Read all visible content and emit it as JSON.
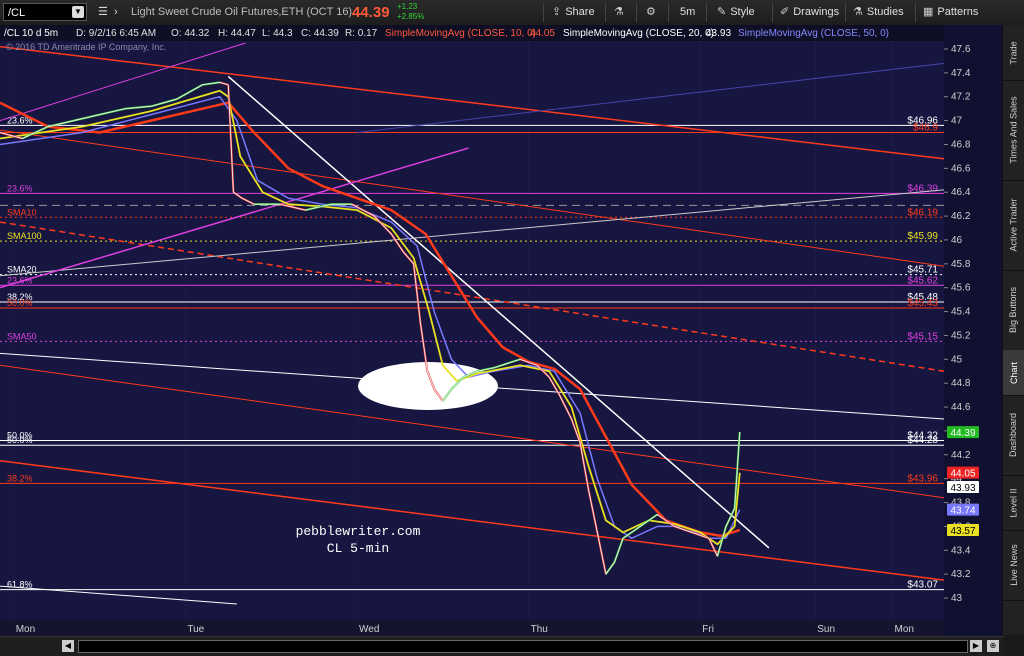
{
  "toolbar": {
    "symbol": "/CL",
    "description": "Light Sweet Crude Oil Futures,ETH (OCT 16)",
    "last_price": "44.39",
    "net_change": "+1.23",
    "pct_change": "+2.85%",
    "share": "Share",
    "aggregation": "5m",
    "style": "Style",
    "drawings": "Drawings",
    "studies": "Studies",
    "patterns": "Patterns"
  },
  "info_bar": {
    "symbol": "/CL 10 d 5m",
    "bar": "D: 9/2/16 6:45 AM",
    "open": "O: 44.32",
    "high": "H: 44.47",
    "low": "L: 44.3",
    "close": "C: 44.39",
    "range": "R: 0.17",
    "sma10_label": "SimpleMovingAvg (CLOSE, 10, 0)",
    "sma10_value": "44.05",
    "sma20_label": "SimpleMovingAvg (CLOSE, 20, 0)",
    "sma20_value": "43.93",
    "sma50_label": "SimpleMovingAvg (CLOSE, 50, 0)",
    "copyright": "© 2016 TD Ameritrade IP Company, Inc."
  },
  "side_tabs": [
    "Trade",
    "Times And Sales",
    "Active Trader",
    "Big Buttons",
    "Chart",
    "Dashboard",
    "Level II",
    "Live News"
  ],
  "side_tab_active": "Chart",
  "watermark": [
    "pebblewriter.com",
    "CL 5-min"
  ],
  "colors": {
    "background": "#161640",
    "price": "#e8e8e8",
    "sma10": "#e8e020",
    "sma20": "#7878ff",
    "sma50": "#ff3a1a",
    "orange_channel": "#ff3a1a",
    "magenta": "#e040e0",
    "white_line": "#ffffff",
    "up_candle": "#30d030",
    "down_candle": "#ff3030"
  },
  "chart_data": {
    "type": "line",
    "title": "/CL 10 d 5m",
    "ylim": [
      43.0,
      47.6
    ],
    "y_ticks": [
      43,
      43.2,
      43.4,
      43.6,
      43.8,
      44,
      44.2,
      44.4,
      44.6,
      44.8,
      45,
      45.2,
      45.4,
      45.6,
      45.8,
      46,
      46.2,
      46.4,
      46.6,
      46.8,
      47,
      47.2,
      47.4,
      47.6
    ],
    "x_labels": [
      {
        "label": "Mon",
        "x": 0
      },
      {
        "label": "Tue",
        "x": 1
      },
      {
        "label": "Wed",
        "x": 2
      },
      {
        "label": "Thu",
        "x": 3
      },
      {
        "label": "Fri",
        "x": 4
      },
      {
        "label": "Sun",
        "x": 4.67
      },
      {
        "label": "Mon",
        "x": 5.12
      }
    ],
    "xlim": [
      -0.08,
      5.42
    ],
    "last_x": 4.23,
    "series": [
      {
        "name": "Price",
        "points": [
          [
            -0.08,
            46.9
          ],
          [
            0.05,
            46.85
          ],
          [
            0.2,
            46.95
          ],
          [
            0.35,
            47.0
          ],
          [
            0.5,
            47.05
          ],
          [
            0.65,
            47.1
          ],
          [
            0.8,
            47.12
          ],
          [
            0.95,
            47.18
          ],
          [
            1.1,
            47.3
          ],
          [
            1.2,
            47.32
          ],
          [
            1.25,
            47.3
          ],
          [
            1.28,
            46.4
          ],
          [
            1.33,
            46.35
          ],
          [
            1.4,
            46.3
          ],
          [
            1.55,
            46.3
          ],
          [
            1.7,
            46.25
          ],
          [
            1.85,
            46.3
          ],
          [
            1.97,
            46.3
          ],
          [
            2.1,
            46.2
          ],
          [
            2.2,
            46.05
          ],
          [
            2.27,
            45.9
          ],
          [
            2.33,
            45.8
          ],
          [
            2.37,
            45.3
          ],
          [
            2.41,
            44.9
          ],
          [
            2.45,
            44.75
          ],
          [
            2.5,
            44.65
          ],
          [
            2.55,
            44.75
          ],
          [
            2.62,
            44.85
          ],
          [
            2.7,
            44.9
          ],
          [
            2.8,
            44.93
          ],
          [
            2.95,
            45.0
          ],
          [
            3.05,
            44.95
          ],
          [
            3.12,
            44.85
          ],
          [
            3.18,
            44.7
          ],
          [
            3.25,
            44.5
          ],
          [
            3.3,
            44.3
          ],
          [
            3.35,
            43.9
          ],
          [
            3.4,
            43.55
          ],
          [
            3.45,
            43.2
          ],
          [
            3.5,
            43.3
          ],
          [
            3.55,
            43.5
          ],
          [
            3.65,
            43.6
          ],
          [
            3.75,
            43.7
          ],
          [
            3.85,
            43.6
          ],
          [
            3.95,
            43.55
          ],
          [
            4.05,
            43.5
          ],
          [
            4.1,
            43.35
          ],
          [
            4.15,
            43.6
          ],
          [
            4.2,
            43.75
          ],
          [
            4.23,
            44.39
          ]
        ]
      },
      {
        "name": "SMA10",
        "points": [
          [
            -0.08,
            46.85
          ],
          [
            0.4,
            46.95
          ],
          [
            0.8,
            47.08
          ],
          [
            1.2,
            47.25
          ],
          [
            1.25,
            47.2
          ],
          [
            1.32,
            46.7
          ],
          [
            1.45,
            46.4
          ],
          [
            1.6,
            46.3
          ],
          [
            1.8,
            46.28
          ],
          [
            2.0,
            46.25
          ],
          [
            2.2,
            46.1
          ],
          [
            2.33,
            45.85
          ],
          [
            2.42,
            45.4
          ],
          [
            2.5,
            44.95
          ],
          [
            2.58,
            44.82
          ],
          [
            2.7,
            44.88
          ],
          [
            2.95,
            44.95
          ],
          [
            3.12,
            44.9
          ],
          [
            3.25,
            44.6
          ],
          [
            3.35,
            44.1
          ],
          [
            3.45,
            43.65
          ],
          [
            3.55,
            43.55
          ],
          [
            3.7,
            43.65
          ],
          [
            3.85,
            43.62
          ],
          [
            4.0,
            43.55
          ],
          [
            4.1,
            43.45
          ],
          [
            4.2,
            43.6
          ],
          [
            4.23,
            44.05
          ]
        ]
      },
      {
        "name": "SMA20",
        "points": [
          [
            -0.08,
            46.8
          ],
          [
            0.4,
            46.9
          ],
          [
            0.8,
            47.05
          ],
          [
            1.2,
            47.2
          ],
          [
            1.3,
            47.0
          ],
          [
            1.42,
            46.5
          ],
          [
            1.6,
            46.35
          ],
          [
            1.8,
            46.3
          ],
          [
            2.0,
            46.27
          ],
          [
            2.2,
            46.15
          ],
          [
            2.35,
            45.95
          ],
          [
            2.45,
            45.4
          ],
          [
            2.55,
            45.0
          ],
          [
            2.65,
            44.85
          ],
          [
            2.8,
            44.9
          ],
          [
            3.0,
            44.95
          ],
          [
            3.15,
            44.9
          ],
          [
            3.3,
            44.55
          ],
          [
            3.4,
            44.0
          ],
          [
            3.5,
            43.6
          ],
          [
            3.6,
            43.5
          ],
          [
            3.75,
            43.6
          ],
          [
            3.9,
            43.6
          ],
          [
            4.05,
            43.5
          ],
          [
            4.15,
            43.5
          ],
          [
            4.23,
            43.74
          ]
        ]
      },
      {
        "name": "SMA50",
        "points": [
          [
            -0.08,
            47.15
          ],
          [
            0.2,
            46.95
          ],
          [
            0.5,
            46.9
          ],
          [
            0.8,
            47.0
          ],
          [
            1.1,
            47.1
          ],
          [
            1.25,
            47.15
          ],
          [
            1.4,
            46.9
          ],
          [
            1.6,
            46.6
          ],
          [
            1.8,
            46.45
          ],
          [
            2.0,
            46.35
          ],
          [
            2.2,
            46.25
          ],
          [
            2.4,
            46.05
          ],
          [
            2.55,
            45.7
          ],
          [
            2.7,
            45.35
          ],
          [
            2.85,
            45.1
          ],
          [
            3.0,
            44.98
          ],
          [
            3.15,
            44.92
          ],
          [
            3.3,
            44.75
          ],
          [
            3.45,
            44.35
          ],
          [
            3.6,
            43.95
          ],
          [
            3.8,
            43.65
          ],
          [
            4.0,
            43.55
          ],
          [
            4.12,
            43.52
          ],
          [
            4.23,
            43.57
          ]
        ]
      }
    ],
    "horizontal_levels": [
      {
        "label": "23.6%",
        "price": 46.96,
        "value_label": "$46.96",
        "color": "#ffffff",
        "style": "solid"
      },
      {
        "label": "",
        "price": 46.9,
        "value_label": "$46.9",
        "color": "#ff3a1a",
        "style": "solid"
      },
      {
        "label": "23.6%",
        "price": 46.39,
        "value_label": "$46.39",
        "color": "#e040e0",
        "style": "solid"
      },
      {
        "label": "",
        "price": 46.29,
        "value_label": "",
        "color": "#999999",
        "style": "dashed"
      },
      {
        "label": "SMA10",
        "price": 46.19,
        "value_label": "$46.19",
        "color": "#ff3a1a",
        "style": "dotted"
      },
      {
        "label": "SMA100",
        "price": 45.99,
        "value_label": "$45.99",
        "color": "#e8e020",
        "style": "dotted"
      },
      {
        "label": "SMA20",
        "price": 45.71,
        "value_label": "$45.71",
        "color": "#ffffff",
        "style": "dotted"
      },
      {
        "label": "23.6%",
        "price": 45.62,
        "value_label": "$45.62",
        "color": "#e040e0",
        "style": "solid"
      },
      {
        "label": "38.2%",
        "price": 45.48,
        "value_label": "$45.48",
        "color": "#ffffff",
        "style": "solid"
      },
      {
        "label": "50.0%",
        "price": 45.43,
        "value_label": "$45.43",
        "color": "#ff3a1a",
        "style": "solid"
      },
      {
        "label": "SMA50",
        "price": 45.15,
        "value_label": "$45.15",
        "color": "#e040e0",
        "style": "dotted"
      },
      {
        "label": "50.0%",
        "price": 44.32,
        "value_label": "$44.32",
        "color": "#ffffff",
        "style": "solid"
      },
      {
        "label": "50.0%",
        "price": 44.28,
        "value_label": "$44.28",
        "color": "#ffffff",
        "style": "solid"
      },
      {
        "label": "38.2%",
        "price": 43.96,
        "value_label": "$43.96",
        "color": "#ff3a1a",
        "style": "solid"
      },
      {
        "label": "61.8%",
        "price": 43.07,
        "value_label": "$43.07",
        "color": "#ffffff",
        "style": "solid"
      }
    ],
    "trendlines": [
      {
        "color": "#ff3a1a",
        "width": 1.5,
        "dash": "",
        "p1": [
          -0.08,
          47.62
        ],
        "p2": [
          5.42,
          46.68
        ]
      },
      {
        "color": "#ff3a1a",
        "width": 1,
        "dash": "",
        "p1": [
          -0.08,
          46.92
        ],
        "p2": [
          5.42,
          45.78
        ]
      },
      {
        "color": "#ff3a1a",
        "width": 1.5,
        "dash": "6,4",
        "p1": [
          -0.08,
          46.15
        ],
        "p2": [
          5.42,
          44.9
        ]
      },
      {
        "color": "#ff3a1a",
        "width": 1,
        "dash": "",
        "p1": [
          -0.08,
          44.95
        ],
        "p2": [
          5.42,
          43.84
        ]
      },
      {
        "color": "#ff3a1a",
        "width": 1.5,
        "dash": "",
        "p1": [
          -0.08,
          44.15
        ],
        "p2": [
          5.42,
          43.15
        ]
      },
      {
        "color": "#ffffff",
        "width": 1.5,
        "dash": "",
        "p1": [
          1.25,
          47.37
        ],
        "p2": [
          4.4,
          43.42
        ]
      },
      {
        "color": "#ffffff",
        "width": 1,
        "dash": "",
        "p1": [
          -0.08,
          45.05
        ],
        "p2": [
          5.42,
          44.5
        ]
      },
      {
        "color": "#cccccc",
        "width": 1,
        "dash": "",
        "p1": [
          -0.08,
          45.7
        ],
        "p2": [
          5.42,
          46.42
        ]
      },
      {
        "color": "#ffffff",
        "width": 1,
        "dash": "",
        "p1": [
          -0.08,
          43.1
        ],
        "p2": [
          1.3,
          42.95
        ]
      },
      {
        "color": "#e040e0",
        "width": 1.5,
        "dash": "",
        "p1": [
          -0.08,
          45.6
        ],
        "p2": [
          2.65,
          46.77
        ]
      },
      {
        "color": "#e040e0",
        "width": 1,
        "dash": "",
        "p1": [
          -0.08,
          47.0
        ],
        "p2": [
          1.35,
          47.65
        ]
      },
      {
        "color": "#4444aa",
        "width": 1,
        "dash": "",
        "p1": [
          2.0,
          46.9
        ],
        "p2": [
          5.42,
          47.48
        ]
      }
    ],
    "right_badges": [
      {
        "value": "44.39",
        "price": 44.39,
        "bg": "#22bb22",
        "fg": "#ffffff"
      },
      {
        "value": "44.05",
        "price": 44.05,
        "bg": "#ee2222",
        "fg": "#ffffff"
      },
      {
        "value": "43.93",
        "price": 43.93,
        "bg": "#ffffff",
        "fg": "#000000"
      },
      {
        "value": "43.74",
        "price": 43.74,
        "bg": "#7878ff",
        "fg": "#ffffff"
      },
      {
        "value": "43.57",
        "price": 43.57,
        "bg": "#e8e020",
        "fg": "#000000"
      }
    ]
  }
}
